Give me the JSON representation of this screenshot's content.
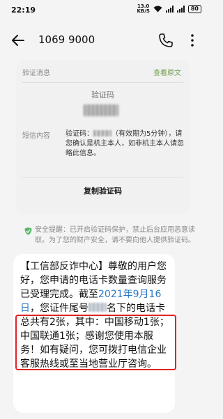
{
  "status_bar": {
    "time": "22:19",
    "net_speed_value": "13.0",
    "net_speed_unit": "KB/S",
    "battery": "80"
  },
  "header": {
    "sender": "1069 9000"
  },
  "verification_card": {
    "title": "验证消息",
    "view_original": "查看原文",
    "code_label": "验证码",
    "sms_label": "短信内容",
    "sms_prefix": "验证码：",
    "sms_rest": "（有效期为5分钟），请您确认是机主本人，如非机主本人请忽略此信息。",
    "copy_button": "复制验证码"
  },
  "safety_notice": {
    "text": "安全提醒：已开启验证码保护，禁止后台应用恶意读取。为了您的财产安全，请不要向他人提供验证码。"
  },
  "message": {
    "part1": "【工信部反诈中心】尊敬的用户您好，您申请的电话卡数量查询服务已受理完成。截至",
    "date": "2021年9月16日",
    "part2": "，您证件尾号",
    "part3": "名下的电话卡总共有2张，其中：中国移动1张；中国联通1张；感谢您使用本服务！如有疑问，您可拨打电信企业客服热线或至当地营业厅咨询。"
  },
  "colors": {
    "accent_green": "#6f9e4e",
    "link_blue": "#2b78c8",
    "highlight_red": "#e02424"
  },
  "icons": [
    "back-arrow-icon",
    "phone-icon",
    "more-vertical-icon",
    "shield-check-icon",
    "wifi-icon",
    "signal-icon",
    "battery-icon"
  ]
}
